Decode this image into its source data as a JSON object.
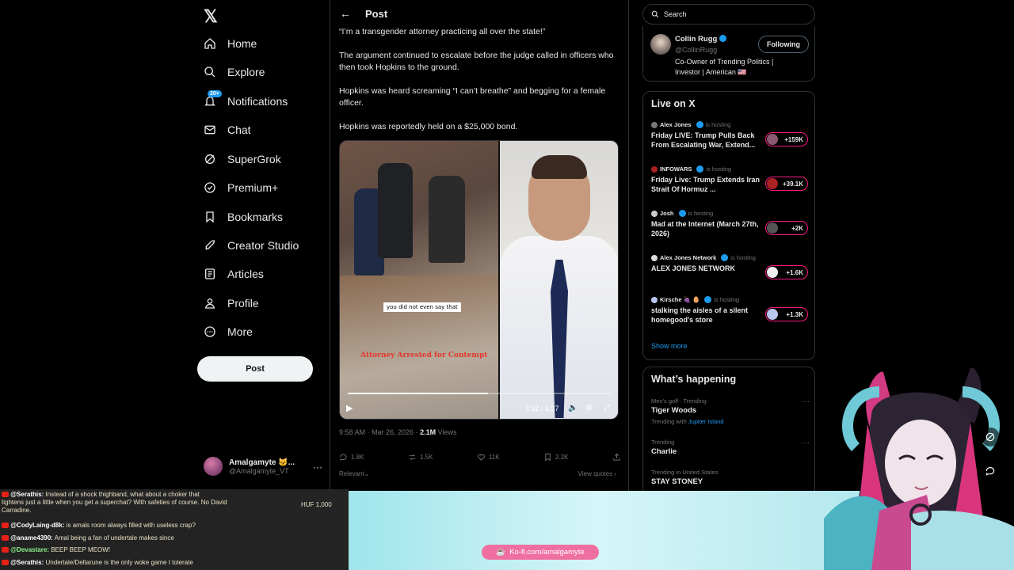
{
  "nav": {
    "logo": "𝕏",
    "items": [
      {
        "label": "Home"
      },
      {
        "label": "Explore"
      },
      {
        "label": "Notifications",
        "badge": "20+"
      },
      {
        "label": "Chat"
      },
      {
        "label": "SuperGrok"
      },
      {
        "label": "Premium+"
      },
      {
        "label": "Bookmarks"
      },
      {
        "label": "Creator Studio"
      },
      {
        "label": "Articles"
      },
      {
        "label": "Profile"
      },
      {
        "label": "More"
      }
    ],
    "post_button": "Post",
    "account": {
      "name": "Amalgamyte 🐱...",
      "handle": "@Amalgamyte_VT",
      "more": "···"
    }
  },
  "post": {
    "header_title": "Post",
    "paragraphs": [
      "“I’m a transgender attorney practicing all over the state!”",
      "The argument continued to escalate before the judge called in officers who then took Hopkins to the ground.",
      "Hopkins was heard screaming “I can’t breathe” and begging for a female officer.",
      "Hopkins was reportedly held on a $25,000 bond."
    ],
    "video": {
      "caption": "you did not even say that",
      "overlay_text": "Attorney Arrested for Contempt",
      "time": "3:32 / 6:37",
      "progress": 0.533
    },
    "meta": {
      "timestamp": "9:58 AM · Mar 26, 2026 ·",
      "views": "2.1M",
      "views_label": "Views"
    },
    "actions": {
      "replies": "1.8K",
      "reposts": "1.5K",
      "likes": "11K",
      "bookmarks": "2.2K"
    },
    "relevant": "Relevant",
    "view_quotes": "View quotes"
  },
  "sidebar": {
    "search_placeholder": "Search",
    "profile": {
      "name": "Collin Rugg",
      "handle": "@CollinRugg",
      "bio": "Co-Owner of Trending Politics | Investor | American 🇺🇸",
      "follow_label": "Following"
    },
    "live": {
      "title": "Live on X",
      "items": [
        {
          "host": "Alex Jones",
          "status": "is hosting",
          "title": "Friday LIVE: Trump Pulls Back From Escalating War, Extend...",
          "count": "+159K"
        },
        {
          "host": "INFOWARS",
          "status": "is hosting",
          "title": "Friday Live: Trump Extends Iran Strait Of Hormuz ...",
          "count": "+39.1K"
        },
        {
          "host": "Josh",
          "status": "is hosting",
          "title": "Mad at the Internet (March 27th, 2026)",
          "count": "+2K"
        },
        {
          "host": "Alex Jones Network",
          "status": "is hosting",
          "title": "ALEX JONES NETWORK",
          "count": "+1.6K"
        },
        {
          "host": "Kirsche 🍇 🥚",
          "status": "is hosting",
          "title": "stalking the aisles of a silent homegood's store",
          "count": "+1.3K"
        }
      ],
      "show_more": "Show more"
    },
    "happening": {
      "title": "What’s happening",
      "trends": [
        {
          "context": "Men's golf · Trending",
          "name": "Tiger Woods",
          "sub_prefix": "Trending with",
          "sub_link": "Jupiter Island"
        },
        {
          "context": "Trending",
          "name": "Charlie"
        },
        {
          "context": "Trending in United States",
          "name": "STAY STONEY"
        }
      ]
    }
  },
  "stream": {
    "chat": [
      {
        "user": "@Serathis:",
        "msg": "Instead of a shock thighband, what about a choker that tightens just a little when you get a superchat? With safeties of course. No David Carradine."
      },
      {
        "user": "@CodyLaing-d8k:",
        "msg": "is amals room always filled with useless crap?"
      },
      {
        "user": "@aname4390:",
        "msg": "Amal being a fan of undertale makes since"
      },
      {
        "user": "@Devastare:",
        "msg": "BEEP BEEP MEOW!"
      },
      {
        "user": "@Serathis:",
        "msg": "Undertale/Deltarune is the only woke game I tolerate"
      }
    ],
    "superchat_amount": "HUF 1,000",
    "kofi_label": "Ko-fi.com/amalgamyte"
  },
  "colors": {
    "accent": "#1d9bf0",
    "live_ring": "#f91880",
    "kofi": "#ef6fa0",
    "background": "#000000"
  }
}
